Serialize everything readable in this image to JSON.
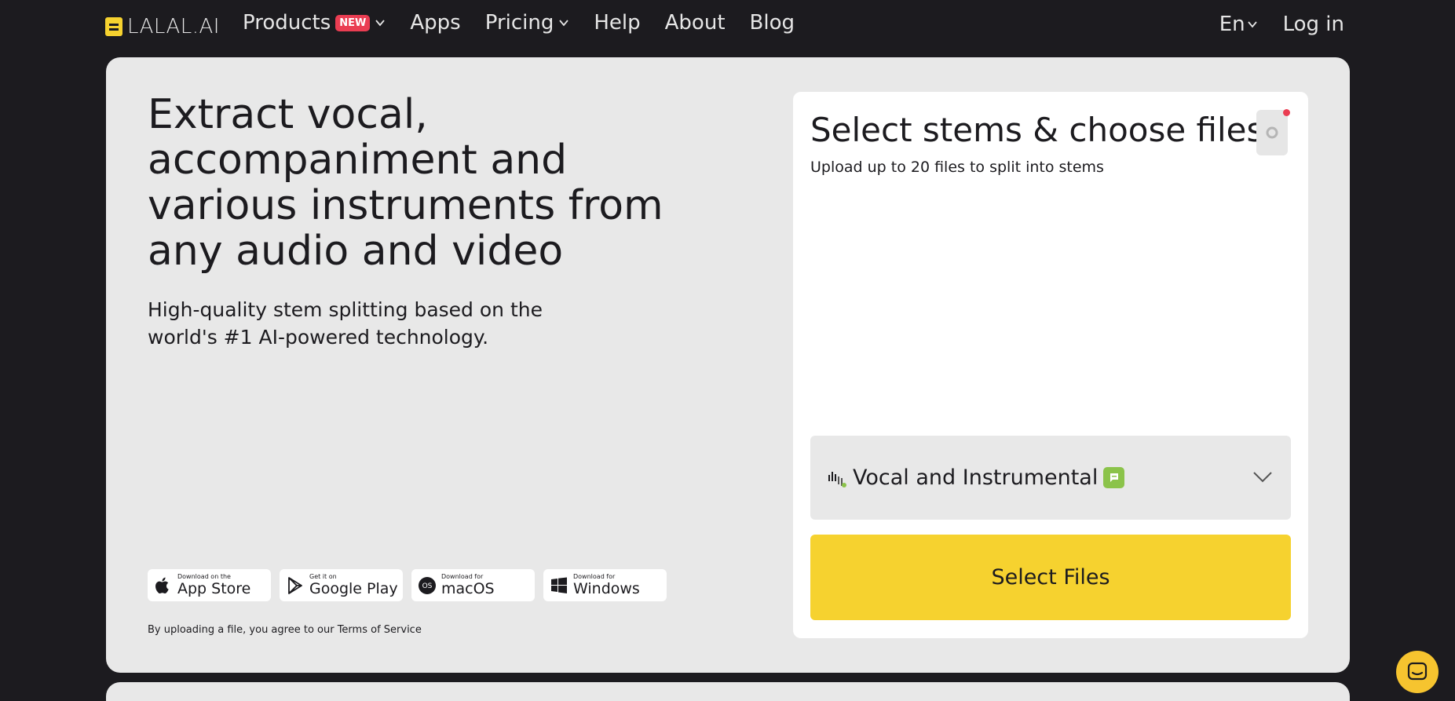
{
  "header": {
    "logo_text": "LALAL.AI",
    "nav": [
      {
        "label": "Products",
        "badge": "NEW",
        "dropdown": true
      },
      {
        "label": "Apps"
      },
      {
        "label": "Pricing",
        "dropdown": true
      },
      {
        "label": "Help"
      },
      {
        "label": "About"
      },
      {
        "label": "Blog"
      }
    ],
    "lang": "En",
    "login": "Log in"
  },
  "hero": {
    "headline": "Extract vocal, accompaniment and various instruments from any audio and video",
    "subhead": "High-quality stem splitting based on the world's #1 AI-powered technology."
  },
  "stores": [
    {
      "small": "Download on the",
      "big": "App Store",
      "icon": "apple-icon"
    },
    {
      "small": "Get it on",
      "big": "Google Play",
      "icon": "google-play-icon"
    },
    {
      "small": "Download for",
      "big": "macOS",
      "icon": "macos-icon"
    },
    {
      "small": "Download for",
      "big": "Windows",
      "icon": "windows-icon"
    }
  ],
  "terms": {
    "prefix": "By uploading a file, you agree to our ",
    "link": "Terms of Service"
  },
  "panel": {
    "title": "Select stems & choose files",
    "subtitle": "Upload up to 20 files to split into stems",
    "stem_selected": "Vocal and Instrumental",
    "select_files": "Select Files"
  },
  "colors": {
    "background": "#1c1b1f",
    "card": "#e8e8e8",
    "accent_yellow": "#f6d22f",
    "badge_red": "#ea3d52",
    "stem_badge_green": "#8bc34a"
  }
}
